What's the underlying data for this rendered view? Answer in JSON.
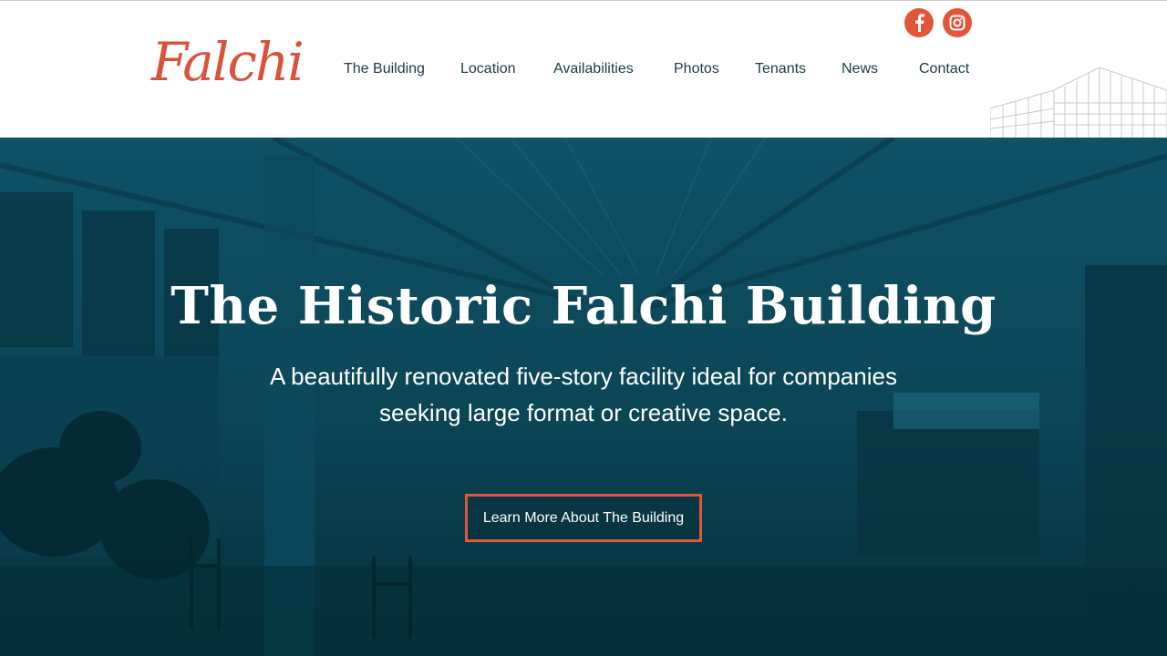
{
  "brand": {
    "logo_text": "Falchi",
    "accent_color": "#e2553a",
    "dark_color": "#0c4a5c"
  },
  "social": [
    {
      "name": "facebook",
      "icon": "facebook-icon"
    },
    {
      "name": "instagram",
      "icon": "instagram-icon"
    }
  ],
  "nav": {
    "items": [
      {
        "label": "The Building"
      },
      {
        "label": "Location"
      },
      {
        "label": "Availabilities"
      },
      {
        "label": "Photos"
      },
      {
        "label": "Tenants"
      },
      {
        "label": "News"
      },
      {
        "label": "Contact"
      }
    ]
  },
  "hero": {
    "title": "The Historic Falchi Building",
    "subtitle_line1": "A beautifully renovated five-story facility ideal for companies",
    "subtitle_line2": "seeking large format or creative space.",
    "cta_label": "Learn More About The Building"
  }
}
